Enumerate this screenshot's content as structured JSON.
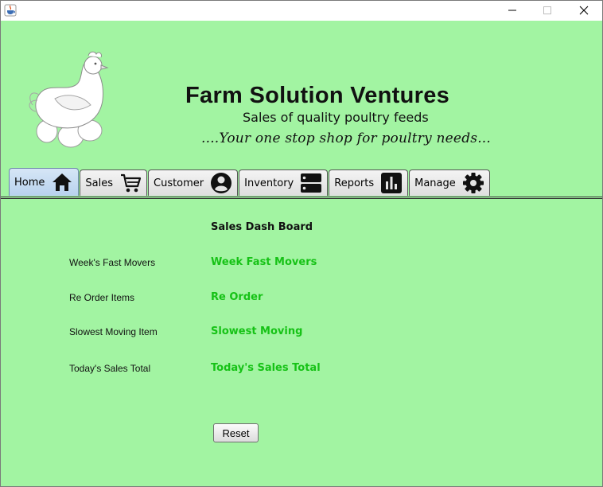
{
  "window": {
    "app_icon": "java-cup-icon",
    "controls": [
      "minimize-icon",
      "maximize-icon",
      "close-icon"
    ]
  },
  "brand": {
    "title": "Farm Solution Ventures",
    "subtitle": "Sales of quality poultry feeds",
    "tagline": "....Your one stop shop for poultry needs..."
  },
  "tabs": [
    {
      "label": "Home",
      "icon": "home-icon",
      "selected": true
    },
    {
      "label": "Sales",
      "icon": "cart-icon",
      "selected": false
    },
    {
      "label": "Customer",
      "icon": "account-icon",
      "selected": false
    },
    {
      "label": "Inventory",
      "icon": "storage-icon",
      "selected": false
    },
    {
      "label": "Reports",
      "icon": "bar-chart-icon",
      "selected": false
    },
    {
      "label": "Manage",
      "icon": "gear-icon",
      "selected": false
    }
  ],
  "dashboard": {
    "title": "Sales Dash Board",
    "rows": [
      {
        "label": "Week's Fast Movers",
        "value": "Week Fast Movers"
      },
      {
        "label": "Re Order Items",
        "value": "Re Order"
      },
      {
        "label": "Slowest Moving Item",
        "value": "Slowest Moving"
      },
      {
        "label": "Today's Sales Total",
        "value": "Today's Sales Total"
      }
    ],
    "reset_label": "Reset"
  },
  "colors": {
    "background": "#a2f4a2",
    "value_text": "#16c216",
    "selected_tab": "#b8d2ee"
  }
}
